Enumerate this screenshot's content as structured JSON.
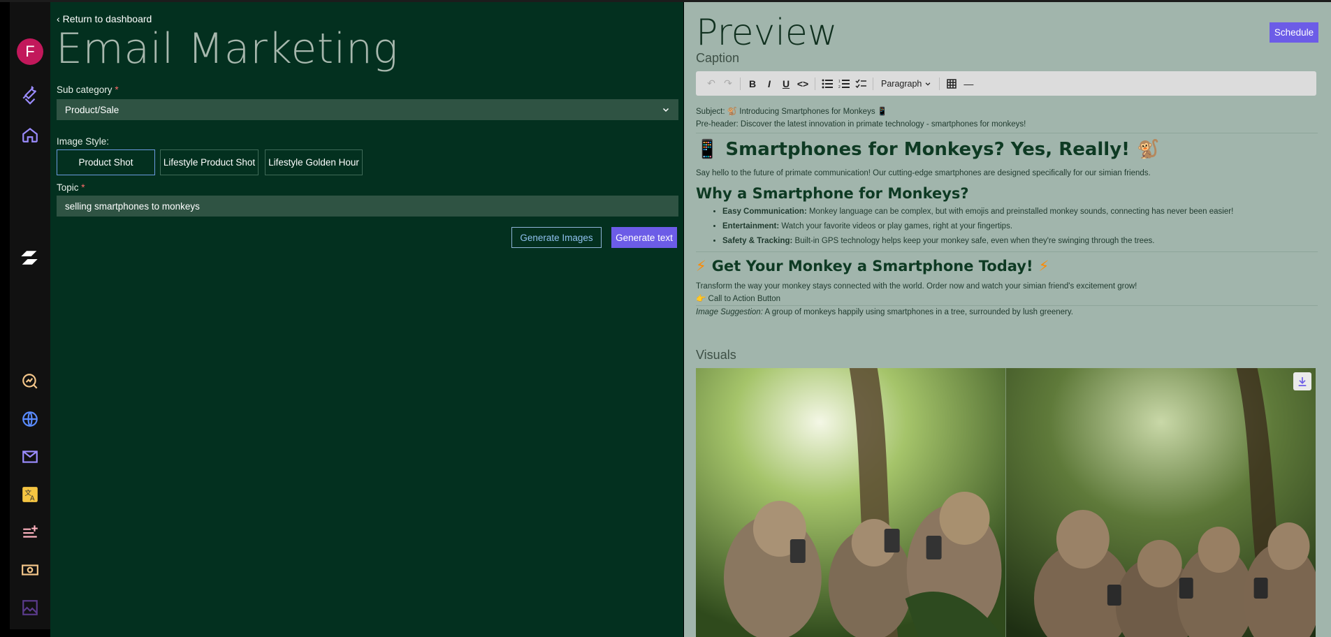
{
  "user": {
    "avatar_initial": "F"
  },
  "nav": {
    "back_label": "Return to dashboard"
  },
  "page": {
    "title": "Email Marketing"
  },
  "form": {
    "subcategory_label": "Sub category",
    "subcategory_value": "Product/Sale",
    "image_style_label": "Image Style:",
    "image_styles": [
      "Product Shot",
      "Lifestyle Product Shot",
      "Lifestyle Golden Hour"
    ],
    "image_style_selected": "Product Shot",
    "topic_label": "Topic",
    "topic_value": "selling smartphones to monkeys",
    "generate_images_label": "Generate Images",
    "generate_text_label": "Generate text"
  },
  "preview": {
    "title": "Preview",
    "schedule_label": "Schedule",
    "caption_label": "Caption",
    "toolbar": {
      "block_format": "Paragraph"
    },
    "subject": "Subject: 🐒 Introducing Smartphones for Monkeys 📱",
    "preheader": "Pre-header: Discover the latest innovation in primate technology - smartphones for monkeys!",
    "heading1": "Smartphones for Monkeys? Yes, Really!",
    "heading1_prefix": "📱",
    "heading1_suffix": "🐒",
    "intro": "Say hello to the future of primate communication! Our cutting-edge smartphones are designed specifically for our simian friends.",
    "heading2": "Why a Smartphone for Monkeys?",
    "bullets": [
      {
        "bold": "Easy Communication:",
        "text": " Monkey language can be complex, but with emojis and preinstalled monkey sounds, connecting has never been easier!"
      },
      {
        "bold": "Entertainment:",
        "text": " Watch your favorite videos or play games, right at your fingertips."
      },
      {
        "bold": "Safety & Tracking:",
        "text": " Built-in GPS technology helps keep your monkey safe, even when they're swinging through the trees."
      }
    ],
    "heading3": "Get Your Monkey a Smartphone Today!",
    "heading3_icon": "⚡",
    "cta_paragraph": "Transform the way your monkey stays connected with the world. Order now and watch your simian friend's excitement grow!",
    "cta_button_line": "👉 Call to Action Button",
    "image_suggestion_label": "Image Suggestion:",
    "image_suggestion_text": " A group of monkeys happily using smartphones in a tree, surrounded by lush greenery.",
    "visuals_label": "Visuals"
  },
  "colors": {
    "accent": "#6c5ce7",
    "left_bg": "#03301f",
    "right_bg": "#a1b5ac",
    "sidebar_bg": "#111111"
  }
}
